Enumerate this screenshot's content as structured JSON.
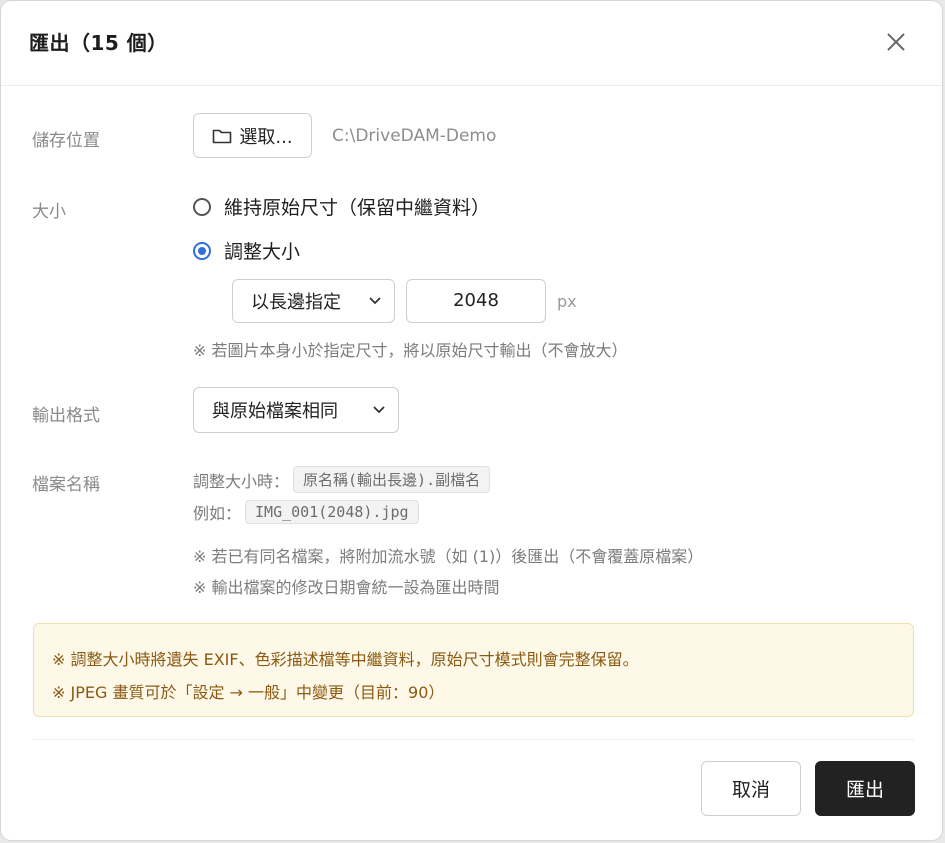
{
  "dialog": {
    "title": "匯出（15 個）",
    "close_icon": "close-icon"
  },
  "location": {
    "label": "儲存位置",
    "choose_label": "選取...",
    "path": "C:\\DriveDAM-Demo"
  },
  "size": {
    "label": "大小",
    "options": [
      "維持原始尺寸（保留中繼資料）",
      "調整大小"
    ],
    "selected_index": 1,
    "edge_select": "以長邊指定",
    "value": "2048",
    "unit": "px",
    "note": "※ 若圖片本身小於指定尺寸，將以原始尺寸輸出（不會放大）"
  },
  "format": {
    "label": "輸出格式",
    "selected": "與原始檔案相同"
  },
  "filename": {
    "label": "檔案名稱",
    "resize_prefix": "調整大小時：",
    "resize_pattern": "原名稱(輸出長邊).副檔名",
    "example_prefix": "例如：",
    "example": "IMG_001(2048).jpg",
    "note1": "※ 若已有同名檔案，將附加流水號（如 (1)）後匯出（不會覆蓋原檔案）",
    "note2": "※ 輸出檔案的修改日期會統一設為匯出時間"
  },
  "warning": {
    "line1": "※ 調整大小時將遺失 EXIF、色彩描述檔等中繼資料，原始尺寸模式則會完整保留。",
    "line2": "※ JPEG 畫質可於「設定 → 一般」中變更（目前：90）"
  },
  "footer": {
    "cancel_label": "取消",
    "export_label": "匯出"
  },
  "colors": {
    "accent": "#2f6fdb",
    "primary_button": "#222222",
    "warning_bg": "#fdf8e8",
    "warning_text": "#8a5a12"
  }
}
